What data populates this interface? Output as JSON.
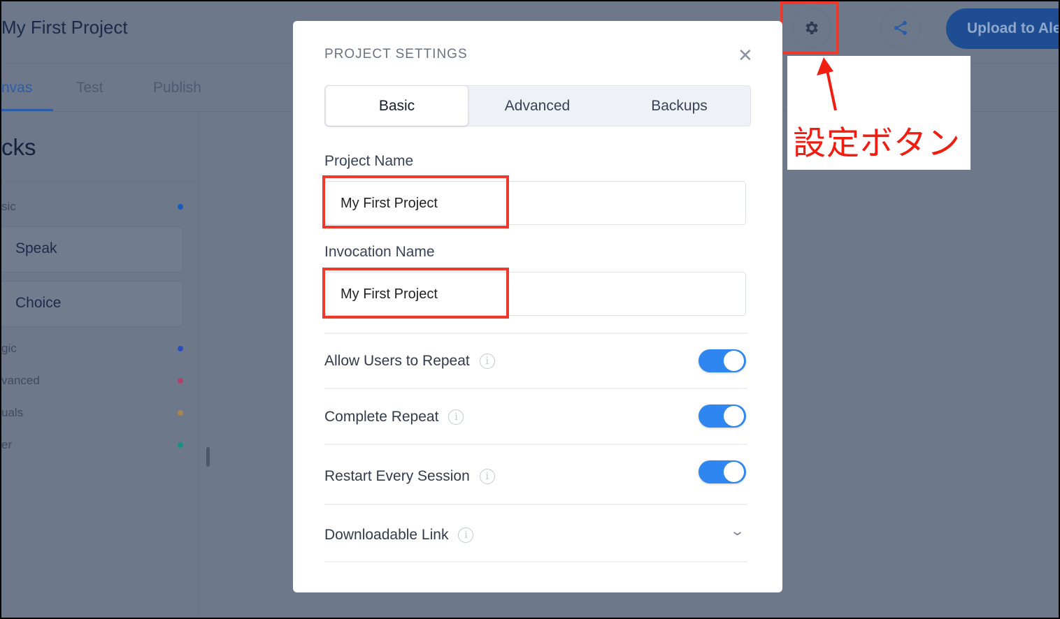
{
  "header": {
    "project_title": "My First Project",
    "upload_label": "Upload to Alexa"
  },
  "nav_tabs": [
    {
      "label": "nvas",
      "active": true
    },
    {
      "label": "Test"
    },
    {
      "label": "Publish"
    }
  ],
  "sidebar": {
    "heading": "cks",
    "sections": [
      "sic",
      "gic",
      "vanced",
      "uals",
      "er"
    ],
    "blocks": [
      "Speak",
      "Choice"
    ],
    "dot_colors": [
      "#1a5bbf",
      "#2a4fc0",
      "#b0416a",
      "#a88650",
      "#1a8f8a"
    ]
  },
  "annotation": {
    "label": "設定ボタン",
    "color": "#f01d10"
  },
  "modal": {
    "title": "PROJECT SETTINGS",
    "tabs": [
      "Basic",
      "Advanced",
      "Backups"
    ],
    "active_tab": "Basic",
    "project_name_label": "Project Name",
    "project_name_value": "My First Project",
    "invocation_name_label": "Invocation Name",
    "invocation_name_value": "My First Project",
    "toggles": [
      {
        "label": "Allow Users to Repeat",
        "on": true
      },
      {
        "label": "Complete Repeat",
        "on": true
      },
      {
        "label": "Restart Every Session",
        "on": true
      }
    ],
    "downloadable_label": "Downloadable Link",
    "accent": "#2f86f0"
  }
}
